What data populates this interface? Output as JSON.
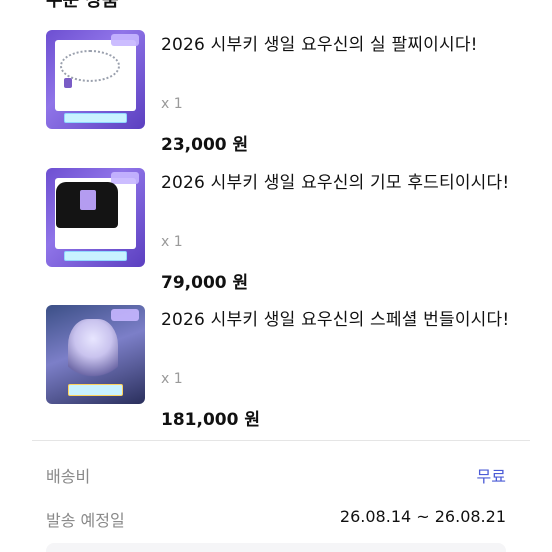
{
  "section": {
    "title": "주문 상품"
  },
  "products": [
    {
      "title": "2026 시부키 생일 요우신의 실 팔찌이시다!",
      "qty": "x 1",
      "price": "23,000 원"
    },
    {
      "title": "2026 시부키 생일 요우신의 기모 후드티이시다!",
      "qty": "x 1",
      "price": "79,000 원"
    },
    {
      "title": "2026 시부키 생일 요우신의 스페셜 번들이시다!",
      "qty": "x 1",
      "price": "181,000 원"
    }
  ],
  "summary": {
    "shipping_label": "배송비",
    "shipping_value": "무료",
    "ship_date_label": "발송 예정일",
    "ship_date_value": "26.08.14 ~ 26.08.21"
  },
  "colors": {
    "accent": "#4b5bd6",
    "muted": "#8a8a8a",
    "thumb_purple": "#6d4fd1"
  }
}
